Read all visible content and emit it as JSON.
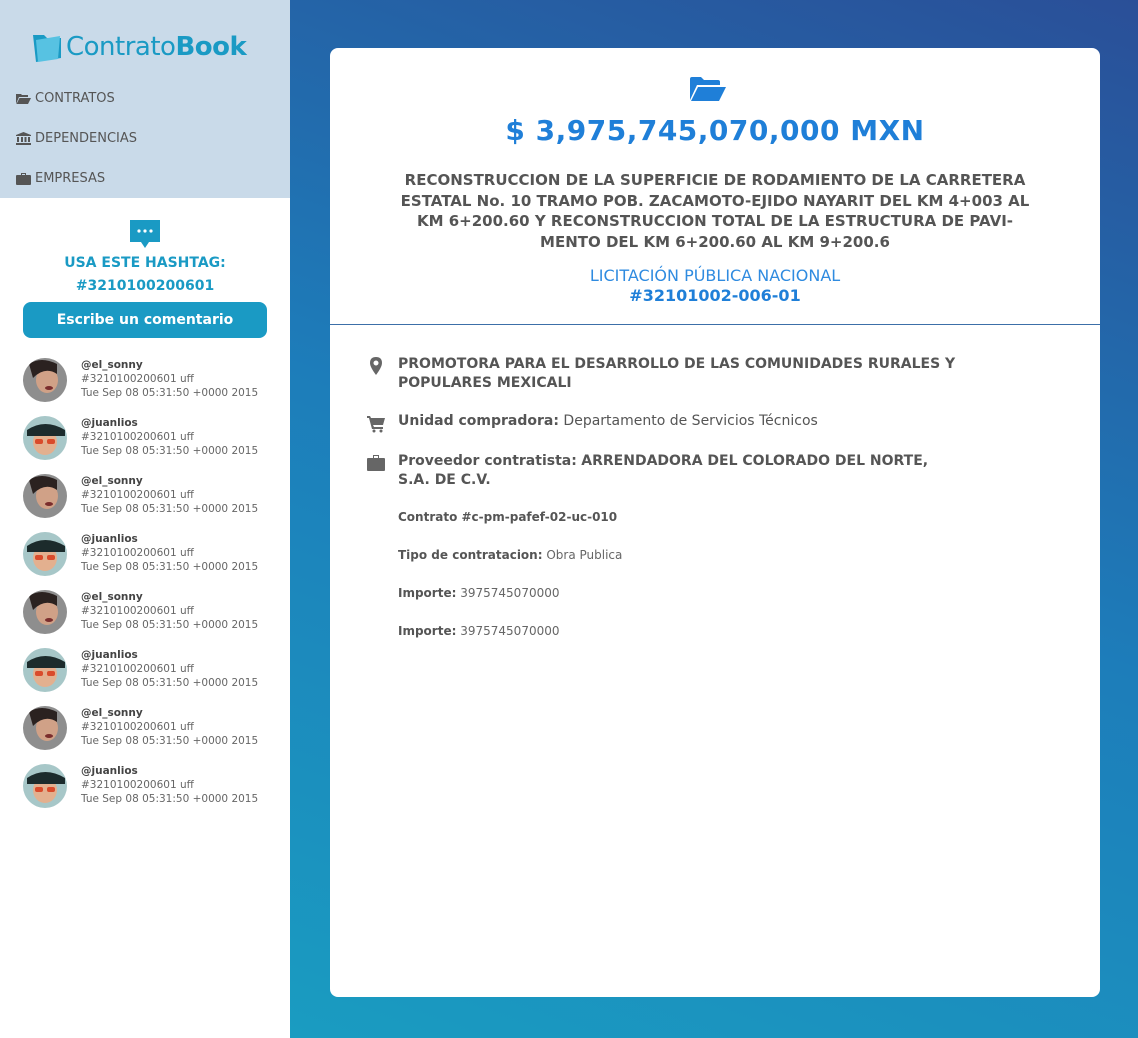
{
  "brand": {
    "light": "Contrato",
    "bold": "Book"
  },
  "nav": [
    {
      "label": "CONTRATOS"
    },
    {
      "label": "DEPENDENCIAS"
    },
    {
      "label": "EMPRESAS"
    }
  ],
  "hashtag": {
    "title": "USA ESTE HASHTAG:",
    "tag": "#3210100200601"
  },
  "comment_button": "Escribe un comentario",
  "comments": [
    {
      "user": "@el_sonny",
      "text": "#3210100200601 uff",
      "time": "Tue Sep 08 05:31:50 +0000 2015"
    },
    {
      "user": "@juanlios",
      "text": "#3210100200601 uff",
      "time": "Tue Sep 08 05:31:50 +0000 2015"
    },
    {
      "user": "@el_sonny",
      "text": "#3210100200601 uff",
      "time": "Tue Sep 08 05:31:50 +0000 2015"
    },
    {
      "user": "@juanlios",
      "text": "#3210100200601 uff",
      "time": "Tue Sep 08 05:31:50 +0000 2015"
    },
    {
      "user": "@el_sonny",
      "text": "#3210100200601 uff",
      "time": "Tue Sep 08 05:31:50 +0000 2015"
    },
    {
      "user": "@juanlios",
      "text": "#3210100200601 uff",
      "time": "Tue Sep 08 05:31:50 +0000 2015"
    },
    {
      "user": "@el_sonny",
      "text": "#3210100200601 uff",
      "time": "Tue Sep 08 05:31:50 +0000 2015"
    },
    {
      "user": "@juanlios",
      "text": "#3210100200601 uff",
      "time": "Tue Sep 08 05:31:50 +0000 2015"
    }
  ],
  "contract": {
    "amount": "$ 3,975,745,070,000 MXN",
    "description": "RECONSTRUCCION DE LA SUPERFICIE DE RODAMIENTO DE LA CARRETERA ESTATAL No. 10 TRAMO POB. ZACAMOTO-EJIDO NAYARIT DEL KM 4+003 AL KM 6+200.60 Y RECONSTRUCCION TOTAL DE LA ESTRUCTURA DE PAVI-MENTO DEL KM 6+200.60 AL KM 9+200.6",
    "licitacion_type": "LICITACIÓN PÚBLICA NACIONAL",
    "licitacion_number": "#32101002-006-01",
    "dependencia": "PROMOTORA PARA EL DESARROLLO DE LAS COMUNIDADES RURALES Y POPULARES MEXICALI",
    "unidad_label": "Unidad compradora:",
    "unidad_value": "Departamento de Servicios Técnicos",
    "proveedor_label": "Proveedor contratista:",
    "proveedor_value": "ARRENDADORA DEL COLORADO DEL NORTE, S.A. DE C.V.",
    "contrato": "Contrato #c-pm-pafef-02-uc-010",
    "tipo_label": "Tipo de contratacion:",
    "tipo_value": "Obra Publica",
    "importe_label": "Importe:",
    "importe_value": "3975745070000",
    "importe2_label": "Importe:",
    "importe2_value": "3975745070000"
  },
  "colors": {
    "accent": "#1a9ac4",
    "amount": "#1f7fd8",
    "sidebar_top": "#c9dae9"
  }
}
